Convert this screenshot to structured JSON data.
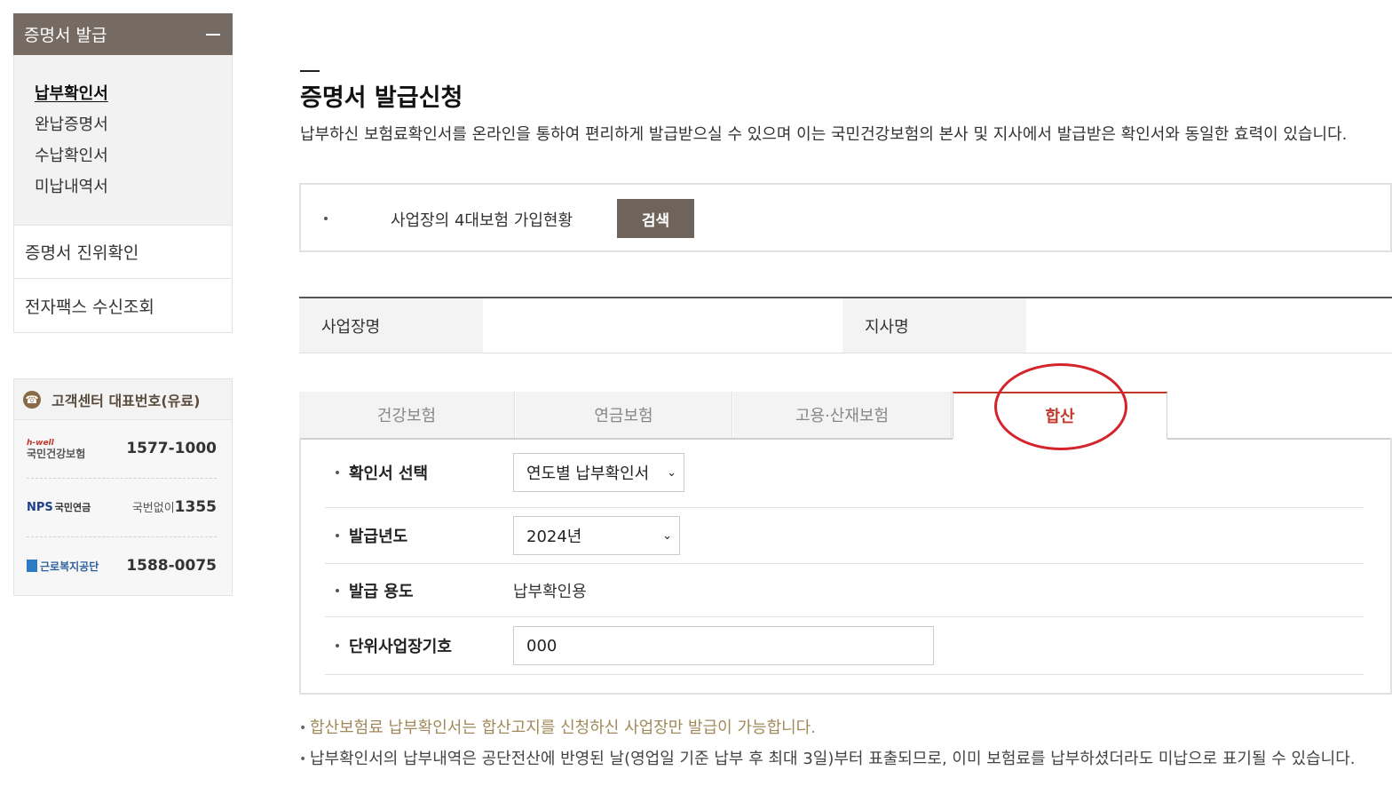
{
  "sidebar": {
    "header": "증명서 발급",
    "sub_items": [
      "납부확인서",
      "완납증명서",
      "수납확인서",
      "미납내역서"
    ],
    "items": [
      "증명서 진위확인",
      "전자팩스 수신조회"
    ]
  },
  "customer_center": {
    "title": "고객센터 대표번호(유료)",
    "rows": [
      {
        "logo_top": "h-well",
        "logo": "국민건강보험",
        "number": "1577-1000"
      },
      {
        "logo_top": "NPS",
        "logo": "국민연금",
        "prefix": "국번없이",
        "number": "1355"
      },
      {
        "logo_top": "",
        "logo": "근로복지공단",
        "number": "1588-0075"
      }
    ]
  },
  "main": {
    "title": "증명서 발급신청",
    "description": "납부하신 보험료확인서를 온라인을 통하여 편리하게 발급받으실 수 있으며 이는 국민건강보험의 본사 및 지사에서 발급받은 확인서와 동일한 효력이 있습니다.",
    "search_label": "사업장의 4대보험 가입현황",
    "search_button": "검색",
    "info": {
      "business_name_label": "사업장명",
      "branch_label": "지사명"
    },
    "tabs": [
      "건강보험",
      "연금보험",
      "고용·산재보험",
      "합산"
    ],
    "active_tab": "합산",
    "form": {
      "cert_select_label": "확인서 선택",
      "cert_select_value": "연도별 납부확인서",
      "year_label": "발급년도",
      "year_value": "2024년",
      "purpose_label": "발급 용도",
      "purpose_value": "납부확인용",
      "unit_label": "단위사업장기호",
      "unit_value": "000"
    },
    "notes": [
      "합산보험료 납부확인서는 합산고지를 신청하신 사업장만 발급이 가능합니다.",
      "납부확인서의 납부내역은 공단전산에 반영된 날(영업일 기준 납부 후 최대 3일)부터 표출되므로, 이미 보험료를 납부하셨더라도 미납으로 표기될 수 있습니다."
    ]
  },
  "colors": {
    "sidebar_header": "#766b63",
    "accent_red": "#c0392b",
    "annotation": "#d4232a",
    "note_gold": "#a08a5a"
  }
}
